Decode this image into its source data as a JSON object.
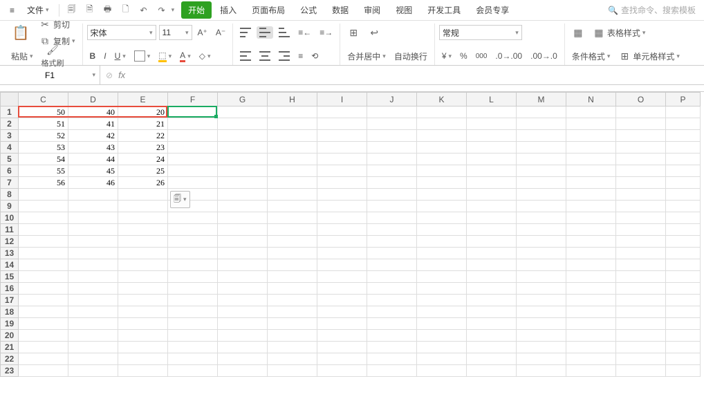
{
  "menu": {
    "file": "文件",
    "tabs": [
      "开始",
      "插入",
      "页面布局",
      "公式",
      "数据",
      "审阅",
      "视图",
      "开发工具",
      "会员专享"
    ],
    "active_tab": 0,
    "search_placeholder": "查找命令、搜索模板"
  },
  "ribbon": {
    "clipboard": {
      "paste": "粘贴",
      "cut": "剪切",
      "copy": "复制",
      "format_painter": "格式刷"
    },
    "font": {
      "name": "宋体",
      "size": "11"
    },
    "alignment": {
      "merge": "合并居中",
      "wrap": "自动换行"
    },
    "number": {
      "format": "常规"
    },
    "styles": {
      "cond": "条件格式",
      "table": "表格样式",
      "cell": "单元格样式"
    }
  },
  "namebox": "F1",
  "formula": "",
  "columns": [
    "C",
    "D",
    "E",
    "F",
    "G",
    "H",
    "I",
    "J",
    "K",
    "L",
    "M",
    "N",
    "O",
    "P"
  ],
  "rows": [
    1,
    2,
    3,
    4,
    5,
    6,
    7,
    8,
    9,
    10,
    11,
    12,
    13,
    14,
    15,
    16,
    17,
    18,
    19,
    20,
    21,
    22,
    23
  ],
  "cells": {
    "C": [
      50,
      51,
      52,
      53,
      54,
      55,
      56
    ],
    "D": [
      40,
      41,
      42,
      43,
      44,
      45,
      46
    ],
    "E": [
      20,
      21,
      22,
      23,
      24,
      25,
      26
    ]
  },
  "highlight_range": "C1:E1",
  "active_cell": "F1",
  "paste_options_label": "粘"
}
